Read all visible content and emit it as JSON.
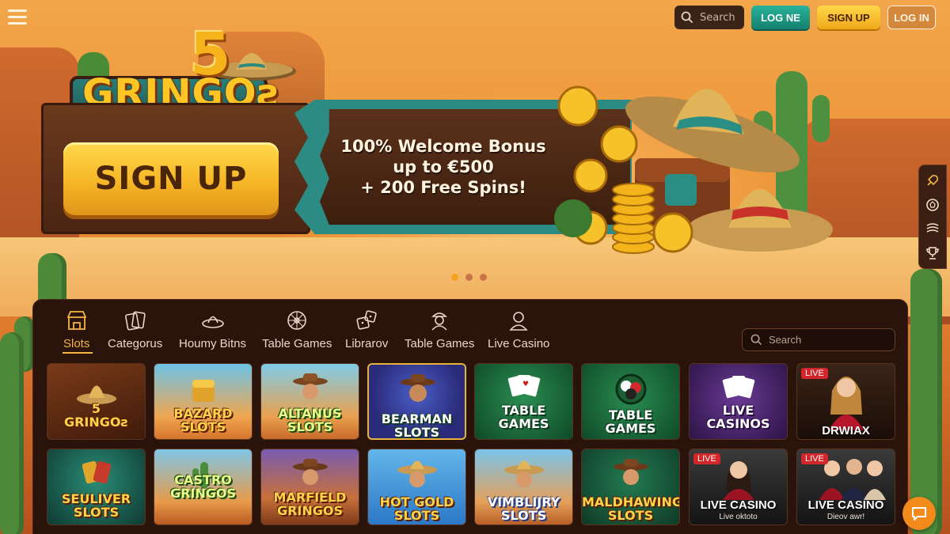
{
  "header": {
    "search_placeholder": "Search",
    "logne_label": "LOG NE",
    "signup_label": "SIGN UP",
    "login_label": "LOG IN"
  },
  "logo": {
    "number": "5",
    "word": "GRINGOƨ"
  },
  "hero": {
    "signup_label": "SIGN UP",
    "bonus_line1": "100% Welcome Bonus",
    "bonus_line2": "up to €500",
    "bonus_line3": "+ 200 Free Spins!",
    "slides": 3,
    "active_slide": 1
  },
  "side_rail": {
    "icons": [
      "rocket-icon",
      "ball-icon",
      "cards-icon",
      "trophy-icon"
    ]
  },
  "lobby": {
    "tabs": [
      {
        "label": "Slots",
        "icon": "store-icon",
        "active": true
      },
      {
        "label": "Categorus",
        "icon": "cards-icon"
      },
      {
        "label": "Houmy Bitns",
        "icon": "hat-icon"
      },
      {
        "label": "Table Games",
        "icon": "wheel-icon"
      },
      {
        "label": "Librarov",
        "icon": "dice-icon"
      },
      {
        "label": "Table Games",
        "icon": "dealer-icon"
      },
      {
        "label": "Live Casino",
        "icon": "person-icon"
      }
    ],
    "search_placeholder": "Search",
    "row1": [
      {
        "title": "5\nGRINGOƨ"
      },
      {
        "title": "BAZARD\nSLOTS"
      },
      {
        "title": "ALTANUS\nSLOTS"
      },
      {
        "title": "BEARMAN\nSLOTS"
      },
      {
        "title": "TABLE\nGAMES"
      },
      {
        "title": "TABLE\nGAMES"
      },
      {
        "title": "LIVE\nCASINOS"
      },
      {
        "title": "DRWIAX",
        "badge": "LIVE"
      }
    ],
    "row2": [
      {
        "title": "SEULIVER\nSLOTS"
      },
      {
        "title": "CASTRO\nGRINGOS"
      },
      {
        "title": "MARFIELD\nGRINGOS"
      },
      {
        "title": "HOT GOLD\nSLOTS"
      },
      {
        "title": "VIMBLIJRY\nSLOTS"
      },
      {
        "title": "MALDHAWING\nSLOTS"
      },
      {
        "title": "LIVE CASINO",
        "subtitle": "Live oktoto",
        "badge": "LIVE"
      },
      {
        "title": "LIVE CASINO",
        "subtitle": "Dieov awr!",
        "badge": "LIVE"
      }
    ]
  },
  "colors": {
    "accent": "#f3b63f",
    "teal": "#1d8f80",
    "panel": "#2a130b",
    "live": "#d3262b"
  }
}
